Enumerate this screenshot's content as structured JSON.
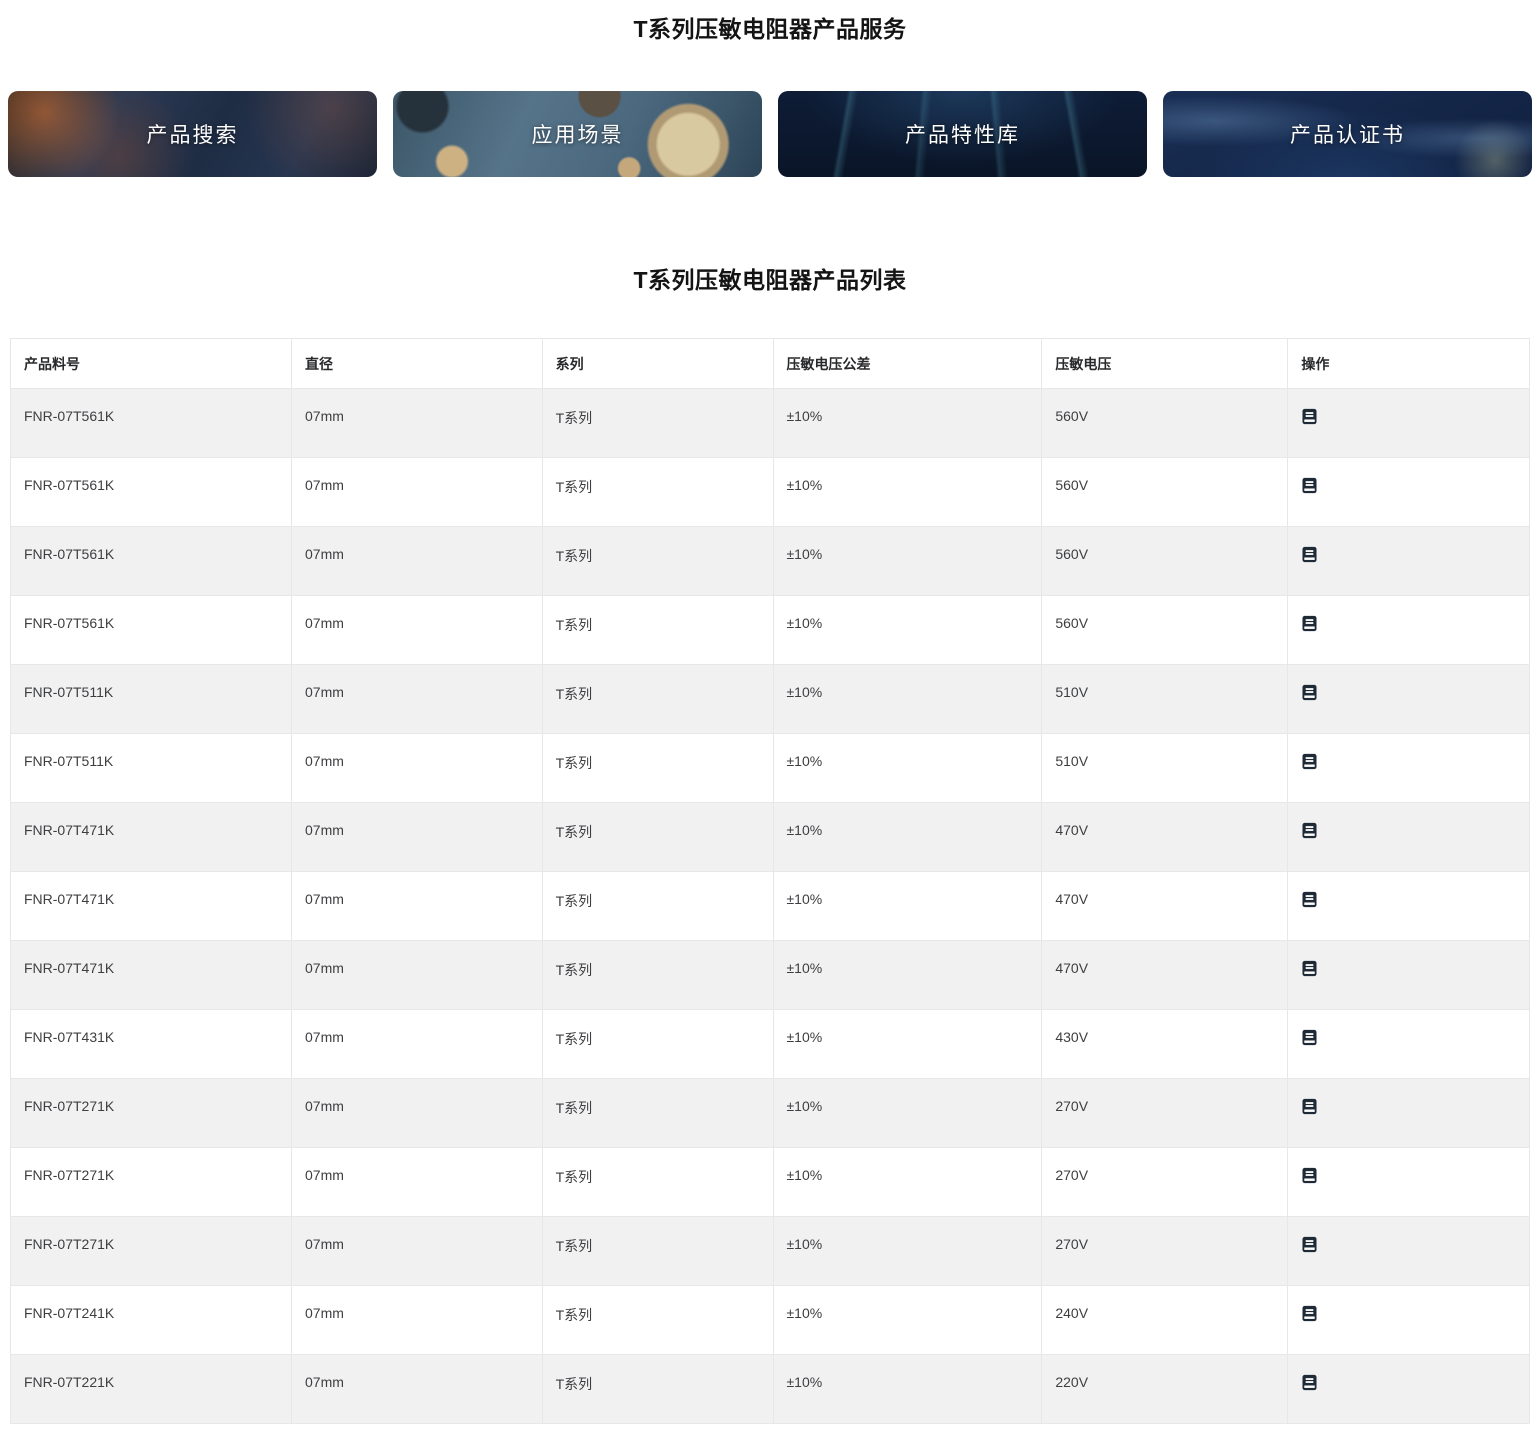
{
  "page": {
    "title": "T系列压敏电阻器产品服务"
  },
  "banners": [
    {
      "label": "产品搜索",
      "image": "dark-circuit-board-photo"
    },
    {
      "label": "应用场景",
      "image": "blue-pcb-components-photo"
    },
    {
      "label": "产品特性库",
      "image": "dark-tech-lines-photo"
    },
    {
      "label": "产品认证书",
      "image": "world-map-network-photo"
    }
  ],
  "list": {
    "title": "T系列压敏电阻器产品列表"
  },
  "table": {
    "headers": {
      "part": "产品料号",
      "diameter": "直径",
      "series": "系列",
      "tolerance": "压敏电压公差",
      "voltage": "压敏电压",
      "operation": "操作"
    },
    "operation_icon": "document-icon",
    "rows": [
      {
        "part": "FNR-07T561K",
        "diameter": "07mm",
        "series": "T系列",
        "tolerance": "±10%",
        "voltage": "560V"
      },
      {
        "part": "FNR-07T561K",
        "diameter": "07mm",
        "series": "T系列",
        "tolerance": "±10%",
        "voltage": "560V"
      },
      {
        "part": "FNR-07T561K",
        "diameter": "07mm",
        "series": "T系列",
        "tolerance": "±10%",
        "voltage": "560V"
      },
      {
        "part": "FNR-07T561K",
        "diameter": "07mm",
        "series": "T系列",
        "tolerance": "±10%",
        "voltage": "560V"
      },
      {
        "part": "FNR-07T511K",
        "diameter": "07mm",
        "series": "T系列",
        "tolerance": "±10%",
        "voltage": "510V"
      },
      {
        "part": "FNR-07T511K",
        "diameter": "07mm",
        "series": "T系列",
        "tolerance": "±10%",
        "voltage": "510V"
      },
      {
        "part": "FNR-07T471K",
        "diameter": "07mm",
        "series": "T系列",
        "tolerance": "±10%",
        "voltage": "470V"
      },
      {
        "part": "FNR-07T471K",
        "diameter": "07mm",
        "series": "T系列",
        "tolerance": "±10%",
        "voltage": "470V"
      },
      {
        "part": "FNR-07T471K",
        "diameter": "07mm",
        "series": "T系列",
        "tolerance": "±10%",
        "voltage": "470V"
      },
      {
        "part": "FNR-07T431K",
        "diameter": "07mm",
        "series": "T系列",
        "tolerance": "±10%",
        "voltage": "430V"
      },
      {
        "part": "FNR-07T271K",
        "diameter": "07mm",
        "series": "T系列",
        "tolerance": "±10%",
        "voltage": "270V"
      },
      {
        "part": "FNR-07T271K",
        "diameter": "07mm",
        "series": "T系列",
        "tolerance": "±10%",
        "voltage": "270V"
      },
      {
        "part": "FNR-07T271K",
        "diameter": "07mm",
        "series": "T系列",
        "tolerance": "±10%",
        "voltage": "270V"
      },
      {
        "part": "FNR-07T241K",
        "diameter": "07mm",
        "series": "T系列",
        "tolerance": "±10%",
        "voltage": "240V"
      },
      {
        "part": "FNR-07T221K",
        "diameter": "07mm",
        "series": "T系列",
        "tolerance": "±10%",
        "voltage": "220V"
      }
    ]
  },
  "colors": {
    "stripe_row": "#f1f1f2",
    "table_border": "#e5e7ea",
    "icon_dark": "#1f2a37",
    "text": "#3d3e40",
    "title": "#141414"
  }
}
